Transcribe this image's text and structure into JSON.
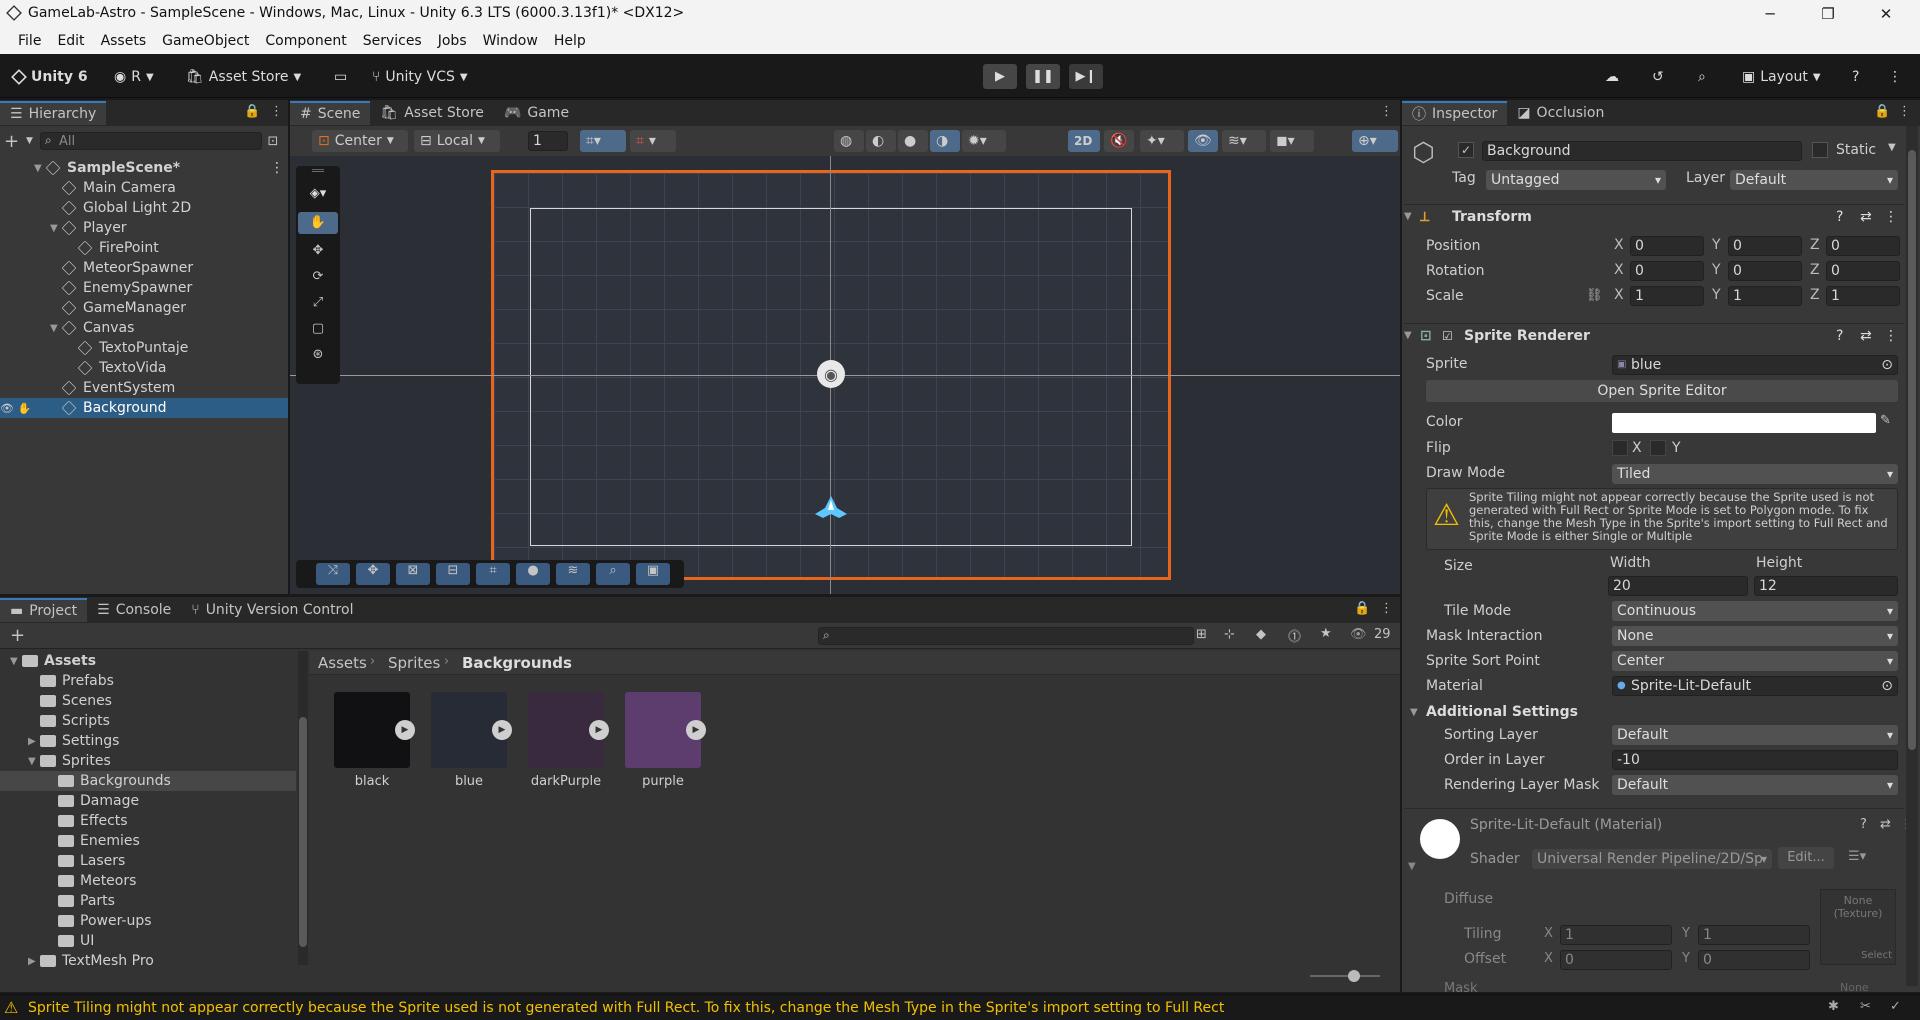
{
  "window": {
    "title": "GameLab-Astro - SampleScene - Windows, Mac, Linux - Unity 6.3 LTS (6000.3.13f1)* <DX12>",
    "minimize": "─",
    "restore": "❐",
    "close": "✕"
  },
  "menu": [
    "File",
    "Edit",
    "Assets",
    "GameObject",
    "Component",
    "Services",
    "Jobs",
    "Window",
    "Help"
  ],
  "toolbar": {
    "unity": "Unity 6",
    "account": "R",
    "asset_store": "Asset Store",
    "vcs": "Unity VCS",
    "layout": "Layout"
  },
  "hierarchy": {
    "tab": "Hierarchy",
    "search_placeholder": "All",
    "items": [
      {
        "label": "SampleScene*",
        "indent": 0,
        "kind": "scene",
        "expand": "▼"
      },
      {
        "label": "Main Camera",
        "indent": 1,
        "kind": "obj",
        "expand": ""
      },
      {
        "label": "Global Light 2D",
        "indent": 1,
        "kind": "obj",
        "expand": ""
      },
      {
        "label": "Player",
        "indent": 1,
        "kind": "obj",
        "expand": "▼"
      },
      {
        "label": "FirePoint",
        "indent": 2,
        "kind": "obj",
        "expand": ""
      },
      {
        "label": "MeteorSpawner",
        "indent": 1,
        "kind": "obj",
        "expand": ""
      },
      {
        "label": "EnemySpawner",
        "indent": 1,
        "kind": "obj",
        "expand": ""
      },
      {
        "label": "GameManager",
        "indent": 1,
        "kind": "obj",
        "expand": ""
      },
      {
        "label": "Canvas",
        "indent": 1,
        "kind": "obj",
        "expand": "▼"
      },
      {
        "label": "TextoPuntaje",
        "indent": 2,
        "kind": "obj",
        "expand": ""
      },
      {
        "label": "TextoVida",
        "indent": 2,
        "kind": "obj",
        "expand": ""
      },
      {
        "label": "EventSystem",
        "indent": 1,
        "kind": "obj",
        "expand": ""
      },
      {
        "label": "Background",
        "indent": 1,
        "kind": "obj",
        "expand": "",
        "selected": true
      }
    ]
  },
  "scene": {
    "tabs": [
      "Scene",
      "Asset Store",
      "Game"
    ],
    "pivot": "Center",
    "space": "Local",
    "snap": "1",
    "mode2d": "2D"
  },
  "inspector": {
    "tabs": [
      "Inspector",
      "Occlusion"
    ],
    "name": "Background",
    "static": "Static",
    "tag_label": "Tag",
    "tag": "Untagged",
    "layer_label": "Layer",
    "layer": "Default",
    "transform": {
      "title": "Transform",
      "position": {
        "label": "Position",
        "x": "0",
        "y": "0",
        "z": "0"
      },
      "rotation": {
        "label": "Rotation",
        "x": "0",
        "y": "0",
        "z": "0"
      },
      "scale": {
        "label": "Scale",
        "x": "1",
        "y": "1",
        "z": "1"
      }
    },
    "sprite_renderer": {
      "title": "Sprite Renderer",
      "sprite_label": "Sprite",
      "sprite": "blue",
      "open_editor": "Open Sprite Editor",
      "color_label": "Color",
      "flip_label": "Flip",
      "flip_x": "X",
      "flip_y": "Y",
      "draw_mode_label": "Draw Mode",
      "draw_mode": "Tiled",
      "warning": "Sprite Tiling might not appear correctly because the Sprite used is not generated with Full Rect or Sprite Mode is set to Polygon mode. To fix this, change the Mesh Type in the Sprite's import setting to Full Rect and Sprite Mode is either Single or Multiple",
      "size_label": "Size",
      "width_label": "Width",
      "height_label": "Height",
      "width": "20",
      "height": "12",
      "tile_mode_label": "Tile Mode",
      "tile_mode": "Continuous",
      "mask_label": "Mask Interaction",
      "mask": "None",
      "sort_point_label": "Sprite Sort Point",
      "sort_point": "Center",
      "material_label": "Material",
      "material": "Sprite-Lit-Default",
      "additional": "Additional Settings",
      "sorting_layer_label": "Sorting Layer",
      "sorting_layer": "Default",
      "order_label": "Order in Layer",
      "order": "-10",
      "rlm_label": "Rendering Layer Mask",
      "rlm": "Default"
    },
    "material": {
      "title": "Sprite-Lit-Default (Material)",
      "shader_label": "Shader",
      "shader": "Universal Render Pipeline/2D/Sp",
      "edit": "Edit...",
      "diffuse": "Diffuse",
      "tiling": "Tiling",
      "offset": "Offset",
      "tx": "1",
      "ty": "1",
      "ox": "0",
      "oy": "0",
      "none_tex": "None (Texture)",
      "select": "Select",
      "mask": "Mask",
      "none": "None"
    }
  },
  "project": {
    "tabs": [
      "Project",
      "Console",
      "Unity Version Control"
    ],
    "count": "29",
    "breadcrumb": [
      "Assets",
      "Sprites",
      "Backgrounds"
    ],
    "tree": [
      {
        "label": "Assets",
        "indent": 0,
        "expand": "▼",
        "bold": true
      },
      {
        "label": "Prefabs",
        "indent": 1,
        "expand": ""
      },
      {
        "label": "Scenes",
        "indent": 1,
        "expand": ""
      },
      {
        "label": "Scripts",
        "indent": 1,
        "expand": ""
      },
      {
        "label": "Settings",
        "indent": 1,
        "expand": "▶"
      },
      {
        "label": "Sprites",
        "indent": 1,
        "expand": "▼"
      },
      {
        "label": "Backgrounds",
        "indent": 2,
        "expand": "",
        "selected": true
      },
      {
        "label": "Damage",
        "indent": 2,
        "expand": ""
      },
      {
        "label": "Effects",
        "indent": 2,
        "expand": ""
      },
      {
        "label": "Enemies",
        "indent": 2,
        "expand": ""
      },
      {
        "label": "Lasers",
        "indent": 2,
        "expand": ""
      },
      {
        "label": "Meteors",
        "indent": 2,
        "expand": ""
      },
      {
        "label": "Parts",
        "indent": 2,
        "expand": ""
      },
      {
        "label": "Power-ups",
        "indent": 2,
        "expand": ""
      },
      {
        "label": "UI",
        "indent": 2,
        "expand": ""
      },
      {
        "label": "TextMesh Pro",
        "indent": 1,
        "expand": "▶"
      }
    ],
    "assets": [
      {
        "name": "black",
        "color": "#111013"
      },
      {
        "name": "blue",
        "color": "#272b35"
      },
      {
        "name": "darkPurple",
        "color": "#3a2a40"
      },
      {
        "name": "purple",
        "color": "#5c3d6e"
      }
    ]
  },
  "status": {
    "message": "Sprite Tiling might not appear correctly because the Sprite used is not generated with Full Rect. To fix this, change the Mesh Type in the Sprite's import setting to Full Rect"
  }
}
